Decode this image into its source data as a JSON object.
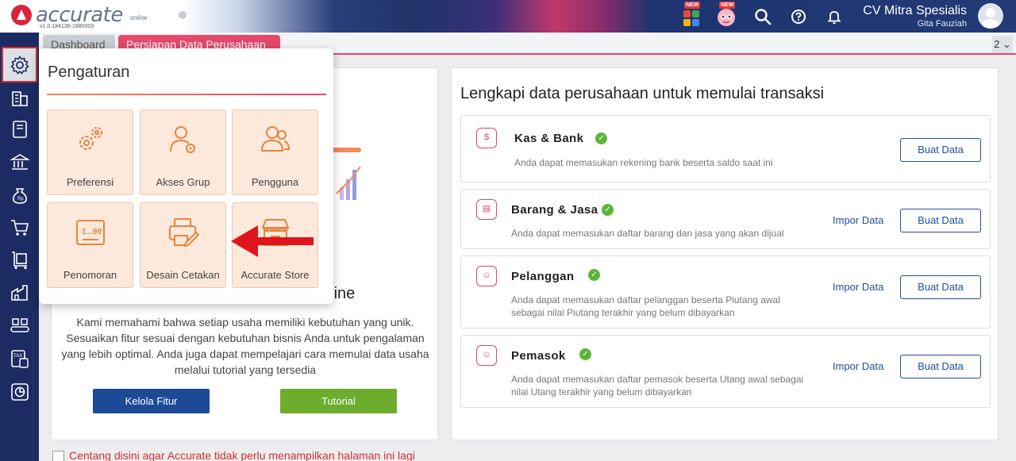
{
  "app": {
    "name": "accurate",
    "suffix": "online",
    "version": "v1.0.1#4136-1880003"
  },
  "topbar": {
    "new_badge_1": "NEW",
    "new_badge_2": "NEW",
    "company_name": "CV Mitra Spesialis",
    "user_name": "Gita Fauziah"
  },
  "tabs": [
    {
      "label": "Dashboard"
    },
    {
      "label": "Persiapan Data Perusahaan"
    }
  ],
  "tab_count": "2 ⌄",
  "popup": {
    "title": "Pengaturan",
    "tiles": [
      {
        "label": "Preferensi",
        "icon": "gears-icon"
      },
      {
        "label": "Akses Grup",
        "icon": "user-group-access-icon"
      },
      {
        "label": "Pengguna",
        "icon": "users-icon"
      },
      {
        "label": "Penomoran",
        "icon": "numbering-icon",
        "glyph": "1...99"
      },
      {
        "label": "Desain Cetakan",
        "icon": "print-design-icon"
      },
      {
        "label": "Accurate Store",
        "icon": "store-icon"
      }
    ]
  },
  "left_card": {
    "title_tail": "nline",
    "text": "Kami memahami bahwa setiap usaha memiliki kebutuhan yang unik. Sesuaikan fitur sesuai dengan kebutuhan bisnis Anda untuk pengalaman yang lebih optimal. Anda juga dapat mempelajari cara memulai data usaha melalui tutorial yang tersedia",
    "btn_kelola": "Kelola Fitur",
    "btn_tutorial": "Tutorial"
  },
  "right_card": {
    "heading": "Lengkapi data perusahaan untuk memulai transaksi",
    "rows": [
      {
        "title": "Kas & Bank",
        "desc": "Anda dapat memasukan rekening bank beserta saldo saat ini",
        "buat": "Buat Data",
        "icon": "cash-bank-icon"
      },
      {
        "title": "Barang & Jasa",
        "desc": "Anda dapat memasukan daftar barang dan jasa yang akan dijual",
        "impor": "Impor Data",
        "buat": "Buat Data",
        "icon": "goods-icon"
      },
      {
        "title": "Pelanggan",
        "desc": "Anda dapat memasukan daftar pelanggan beserta Piutang awal sebagai nilai Piutang terakhir yang belum dibayarkan",
        "impor": "Impor Data",
        "buat": "Buat Data",
        "icon": "customer-icon"
      },
      {
        "title": "Pemasok",
        "desc": "Anda dapat memasukan daftar pemasok beserta Utang awal sebagai nilai Utang terakhir yang belum dibayarkan",
        "impor": "Impor Data",
        "buat": "Buat Data",
        "icon": "supplier-icon"
      }
    ]
  },
  "footer": {
    "checkbox_label": "Centang disini agar Accurate tidak perlu menampilkan halaman ini lagi"
  },
  "colors": {
    "accent_pink": "#e5486b",
    "sidebar_navy": "#1c2c63",
    "link_blue": "#1f4f9e",
    "check_green": "#5bb53b",
    "tile_bg": "#fde9dc",
    "arrow_red": "#e0151b"
  }
}
